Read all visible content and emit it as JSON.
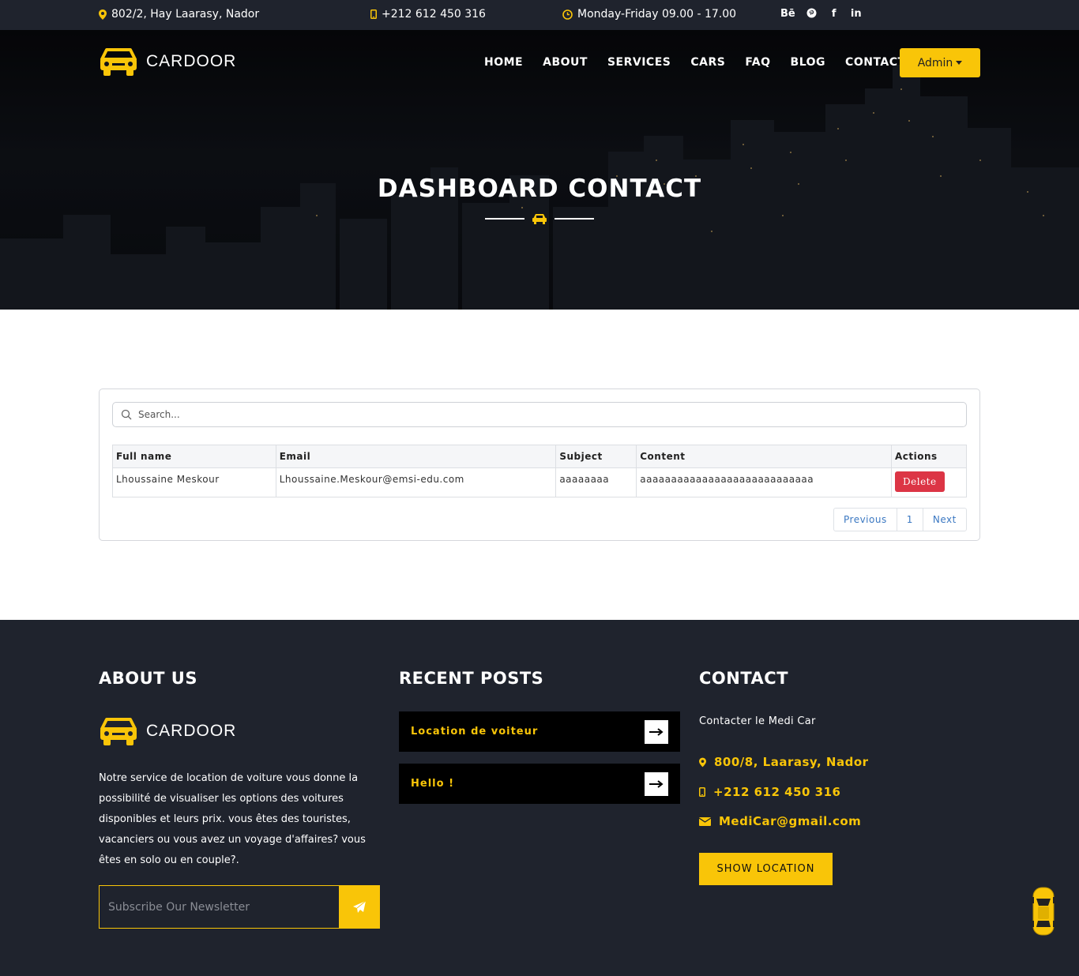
{
  "topbar": {
    "address": "802/2, Hay Laarasy, Nador",
    "phone": "+212 612 450 316",
    "hours": "Monday-Friday 09.00 - 17.00",
    "social": [
      "behance-icon",
      "pinterest-icon",
      "facebook-icon",
      "linkedin-icon"
    ],
    "social_glyphs": {
      "behance": "Bē",
      "pinterest": "℗",
      "facebook": "f",
      "linkedin": "in"
    }
  },
  "brand": {
    "name": "CARDOOR",
    "accent": "#f9c508"
  },
  "nav": {
    "items": [
      "HOME",
      "ABOUT",
      "SERVICES",
      "CARS",
      "FAQ",
      "BLOG",
      "CONTACT"
    ],
    "admin_label": "Admin"
  },
  "hero": {
    "title": "DASHBOARD CONTACT"
  },
  "table": {
    "search_placeholder": "Search...",
    "columns": [
      "Full name",
      "Email",
      "Subject",
      "Content",
      "Actions"
    ],
    "rows": [
      {
        "full_name": "Lhoussaine Meskour",
        "email": "Lhoussaine.Meskour@emsi-edu.com",
        "subject": "aaaaaaaa",
        "content": "aaaaaaaaaaaaaaaaaaaaaaaaaaaa",
        "action": "Delete"
      }
    ],
    "pagination": {
      "previous": "Previous",
      "page": "1",
      "next": "Next"
    }
  },
  "footer": {
    "about": {
      "heading": "ABOUT US",
      "text": "Notre service de location de voiture vous donne la possibilité de visualiser les options des voitures disponibles et leurs prix. vous êtes des touristes, vacanciers ou vous avez un voyage d'affaires? vous êtes en solo ou en couple?.",
      "newsletter_placeholder": "Subscribe Our Newsletter"
    },
    "recent": {
      "heading": "RECENT POSTS",
      "posts": [
        "Location de voiteur",
        "Hello !"
      ]
    },
    "contact": {
      "heading": "CONTACT",
      "subtitle": "Contacter le Medi Car",
      "address": "800/8, Laarasy, Nador",
      "phone": "+212 612 450 316",
      "email": "MediCar@gmail.com",
      "button": "SHOW LOCATION"
    }
  }
}
